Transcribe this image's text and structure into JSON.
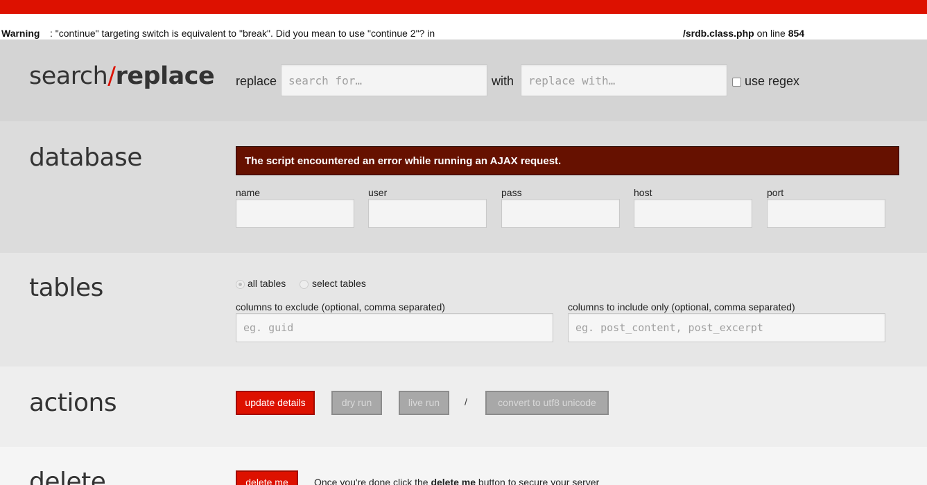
{
  "warning": {
    "label": "Warning",
    "message": ": \"continue\" targeting switch is equivalent to \"break\". Did you mean to use \"continue 2\"? in",
    "file": "/srdb.class.php",
    "on_line_text": " on line ",
    "line": "854"
  },
  "header": {
    "logo_search": "search",
    "logo_slash": "/",
    "logo_replace": "replace",
    "replace_label": "replace",
    "search_placeholder": "search for…",
    "with_label": "with",
    "replace_placeholder": "replace with…",
    "regex_label": "use regex"
  },
  "database": {
    "title": "database",
    "error": "The script encountered an error while running an AJAX request.",
    "fields": [
      {
        "label": "name",
        "value": ""
      },
      {
        "label": "user",
        "value": ""
      },
      {
        "label": "pass",
        "value": ""
      },
      {
        "label": "host",
        "value": ""
      },
      {
        "label": "port",
        "value": ""
      }
    ]
  },
  "tables": {
    "title": "tables",
    "radio_all": "all tables",
    "radio_select": "select tables",
    "exclude_label": "columns to exclude (optional, comma separated)",
    "exclude_placeholder": "eg. guid",
    "include_label": "columns to include only (optional, comma separated)",
    "include_placeholder": "eg. post_content, post_excerpt"
  },
  "actions": {
    "title": "actions",
    "update": "update details",
    "dry_run": "dry run",
    "live_run": "live run",
    "separator": "/",
    "convert": "convert to utf8 unicode"
  },
  "delete": {
    "title": "delete",
    "button": "delete me",
    "text_before": "Once you're done click the ",
    "text_bold": "delete me",
    "text_after": " button to secure your server"
  },
  "colors": {
    "accent": "#dd1100",
    "error_bg": "#661100"
  }
}
